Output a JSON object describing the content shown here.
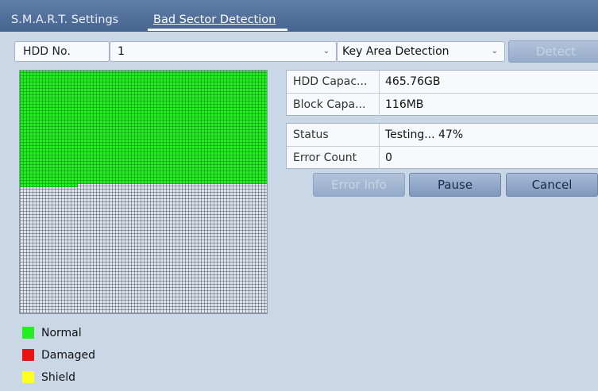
{
  "tabs": [
    {
      "label": "S.M.A.R.T. Settings",
      "active": false
    },
    {
      "label": "Bad Sector Detection",
      "active": true
    }
  ],
  "toolbar": {
    "hdd_label": "HDD No.",
    "hdd_value": "1",
    "detection_type": "Key Area Detection",
    "detect_button": "Detect"
  },
  "disk_info": [
    {
      "label": "HDD Capac...",
      "value": "465.76GB"
    },
    {
      "label": "Block Capa...",
      "value": "116MB"
    }
  ],
  "status_info": [
    {
      "label": "Status",
      "value": "Testing... 47%"
    },
    {
      "label": "Error Count",
      "value": "0"
    }
  ],
  "progress_fraction": 0.47,
  "buttons": {
    "error_info": "Error Info",
    "pause": "Pause",
    "cancel": "Cancel"
  },
  "legend": [
    {
      "label": "Normal",
      "color": "#22ee22"
    },
    {
      "label": "Damaged",
      "color": "#ee1111"
    },
    {
      "label": "Shield",
      "color": "#ffff22"
    }
  ]
}
